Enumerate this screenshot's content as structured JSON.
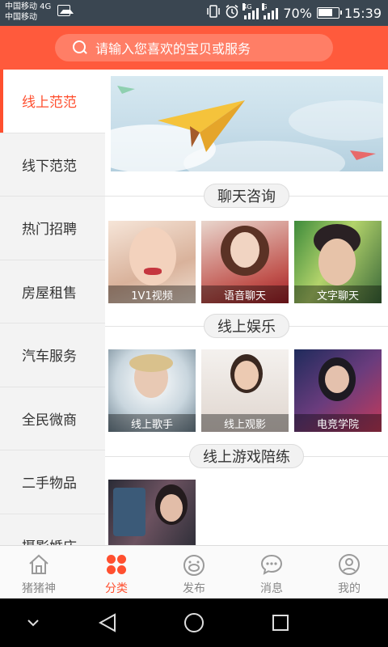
{
  "status_bar": {
    "carrier_1": "中国移动 4G",
    "carrier_2": "中国移动",
    "network_1": "4G",
    "network_2": "G",
    "battery": "70%",
    "time": "15:39"
  },
  "search": {
    "placeholder": "请输入您喜欢的宝贝或服务"
  },
  "sidebar": {
    "items": [
      {
        "label": "线上范范"
      },
      {
        "label": "线下范范"
      },
      {
        "label": "热门招聘"
      },
      {
        "label": "房屋租售"
      },
      {
        "label": "汽车服务"
      },
      {
        "label": "全民微商"
      },
      {
        "label": "二手物品"
      },
      {
        "label": "摄影婚庆"
      }
    ],
    "active_index": 0
  },
  "sections": [
    {
      "title": "聊天咨询",
      "tiles": [
        {
          "label": "1V1视频"
        },
        {
          "label": "语音聊天"
        },
        {
          "label": "文字聊天"
        }
      ]
    },
    {
      "title": "线上娱乐",
      "tiles": [
        {
          "label": "线上歌手"
        },
        {
          "label": "线上观影"
        },
        {
          "label": "电竞学院"
        }
      ]
    },
    {
      "title": "线上游戏陪练",
      "tiles": []
    }
  ],
  "bottom_nav": {
    "items": [
      {
        "label": "猪猪神",
        "icon": "home-icon"
      },
      {
        "label": "分类",
        "icon": "category-icon"
      },
      {
        "label": "发布",
        "icon": "publish-icon"
      },
      {
        "label": "消息",
        "icon": "message-icon"
      },
      {
        "label": "我的",
        "icon": "profile-icon"
      }
    ],
    "active_index": 1
  },
  "colors": {
    "accent": "#ff4f2f",
    "header": "#ff5a3c",
    "status_bar": "#3a4651"
  }
}
